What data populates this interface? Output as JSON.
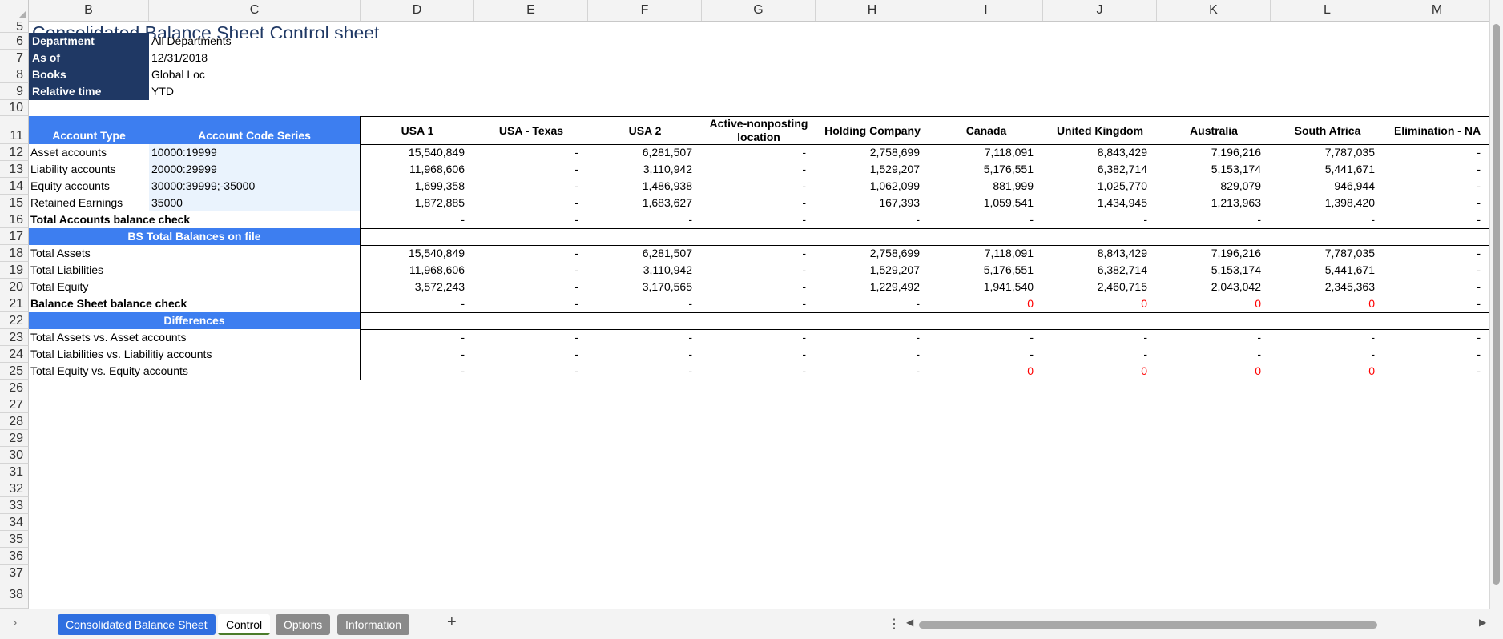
{
  "sheet": {
    "columns": [
      "B",
      "C",
      "D",
      "E",
      "F",
      "G",
      "H",
      "I",
      "J",
      "K",
      "L",
      "M"
    ],
    "rows": [
      "5",
      "6",
      "7",
      "8",
      "9",
      "10",
      "11",
      "12",
      "13",
      "14",
      "15",
      "16",
      "17",
      "18",
      "19",
      "20",
      "21",
      "22",
      "23",
      "24",
      "25",
      "26",
      "27",
      "28",
      "29",
      "30",
      "31",
      "32",
      "33",
      "34",
      "35",
      "36",
      "37",
      "38"
    ],
    "title": "Consolidated Balance Sheet Control sheet",
    "params": [
      {
        "label": "Department",
        "value": "All Departments"
      },
      {
        "label": "As of",
        "value": "12/31/2018"
      },
      {
        "label": "Books",
        "value": "Global Loc"
      },
      {
        "label": "Relative time",
        "value": "YTD"
      }
    ],
    "headers": {
      "account_type": "Account Type",
      "account_code": "Account Code Series",
      "entities": [
        "USA 1",
        "USA - Texas",
        "USA 2",
        "Active-nonposting location",
        "Holding Company",
        "Canada",
        "United Kingdom",
        "Australia",
        "South Africa",
        "Elimination - NA"
      ]
    },
    "accounts": [
      {
        "label": "Asset accounts",
        "code": "10000:19999",
        "values": [
          "15,540,849",
          "-",
          "6,281,507",
          "-",
          "2,758,699",
          "7,118,091",
          "8,843,429",
          "7,196,216",
          "7,787,035",
          "-"
        ]
      },
      {
        "label": "Liability accounts",
        "code": "20000:29999",
        "values": [
          "11,968,606",
          "-",
          "3,110,942",
          "-",
          "1,529,207",
          "5,176,551",
          "6,382,714",
          "5,153,174",
          "5,441,671",
          "-"
        ]
      },
      {
        "label": "Equity accounts",
        "code": "30000:39999;-35000",
        "values": [
          "1,699,358",
          "-",
          "1,486,938",
          "-",
          "1,062,099",
          "881,999",
          "1,025,770",
          "829,079",
          "946,944",
          "-"
        ]
      },
      {
        "label": "Retained Earnings",
        "code": "35000",
        "values": [
          "1,872,885",
          "-",
          "1,683,627",
          "-",
          "167,393",
          "1,059,541",
          "1,434,945",
          "1,213,963",
          "1,398,420",
          "-"
        ]
      }
    ],
    "accounts_check": {
      "label": "Total Accounts balance check",
      "values": [
        "-",
        "-",
        "-",
        "-",
        "-",
        "-",
        "-",
        "-",
        "-",
        "-"
      ]
    },
    "bs_section": "BS Total Balances on file",
    "totals": [
      {
        "label": "Total Assets",
        "values": [
          "15,540,849",
          "-",
          "6,281,507",
          "-",
          "2,758,699",
          "7,118,091",
          "8,843,429",
          "7,196,216",
          "7,787,035",
          "-"
        ]
      },
      {
        "label": "Total Liabilities",
        "values": [
          "11,968,606",
          "-",
          "3,110,942",
          "-",
          "1,529,207",
          "5,176,551",
          "6,382,714",
          "5,153,174",
          "5,441,671",
          "-"
        ]
      },
      {
        "label": "Total Equity",
        "values": [
          "3,572,243",
          "-",
          "3,170,565",
          "-",
          "1,229,492",
          "1,941,540",
          "2,460,715",
          "2,043,042",
          "2,345,363",
          "-"
        ]
      }
    ],
    "bs_check": {
      "label": "Balance Sheet balance check",
      "values": [
        "-",
        "-",
        "-",
        "-",
        "-",
        "0",
        "0",
        "0",
        "0",
        "-"
      ]
    },
    "diff_section": "Differences",
    "differences": [
      {
        "label": "Total Assets vs. Asset accounts",
        "values": [
          "-",
          "-",
          "-",
          "-",
          "-",
          "-",
          "-",
          "-",
          "-",
          "-"
        ]
      },
      {
        "label": "Total Liabilities vs. Liabilitiy accounts",
        "values": [
          "-",
          "-",
          "-",
          "-",
          "-",
          "-",
          "-",
          "-",
          "-",
          "-"
        ]
      },
      {
        "label": "Total Equity vs. Equity accounts",
        "values": [
          "-",
          "-",
          "-",
          "-",
          "-",
          "0",
          "0",
          "0",
          "0",
          "-"
        ]
      }
    ],
    "red_color": "#ff0000",
    "header_blue": "#3d7ef0",
    "param_navy": "#1f3864"
  },
  "tabs": [
    {
      "label": "Consolidated Balance Sheet",
      "style": "blue"
    },
    {
      "label": "Control",
      "style": "active"
    },
    {
      "label": "Options",
      "style": "gray"
    },
    {
      "label": "Information",
      "style": "gray"
    }
  ],
  "tabbar": {
    "add_label": "+",
    "more_label": "⋮",
    "prev_label": "◀",
    "next_label": "▶",
    "nav_label": "›"
  }
}
